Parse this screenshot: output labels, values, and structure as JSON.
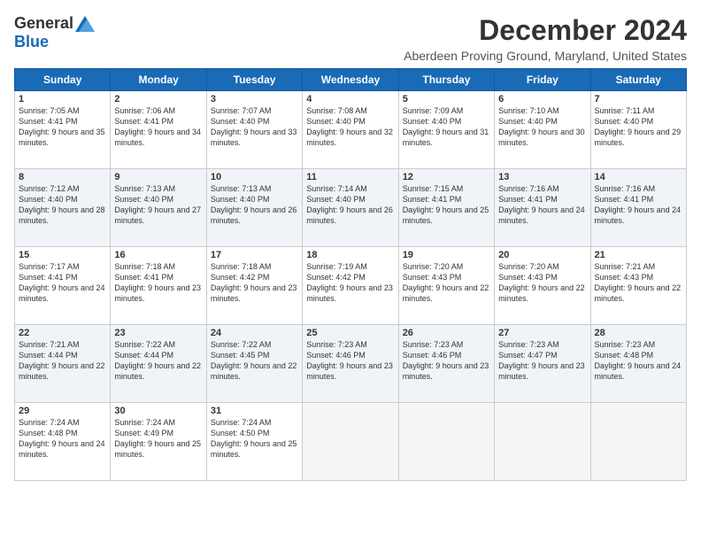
{
  "header": {
    "logo_general": "General",
    "logo_blue": "Blue",
    "main_title": "December 2024",
    "subtitle": "Aberdeen Proving Ground, Maryland, United States"
  },
  "calendar": {
    "days_of_week": [
      "Sunday",
      "Monday",
      "Tuesday",
      "Wednesday",
      "Thursday",
      "Friday",
      "Saturday"
    ],
    "weeks": [
      [
        {
          "day": "1",
          "sunrise": "Sunrise: 7:05 AM",
          "sunset": "Sunset: 4:41 PM",
          "daylight": "Daylight: 9 hours and 35 minutes."
        },
        {
          "day": "2",
          "sunrise": "Sunrise: 7:06 AM",
          "sunset": "Sunset: 4:41 PM",
          "daylight": "Daylight: 9 hours and 34 minutes."
        },
        {
          "day": "3",
          "sunrise": "Sunrise: 7:07 AM",
          "sunset": "Sunset: 4:40 PM",
          "daylight": "Daylight: 9 hours and 33 minutes."
        },
        {
          "day": "4",
          "sunrise": "Sunrise: 7:08 AM",
          "sunset": "Sunset: 4:40 PM",
          "daylight": "Daylight: 9 hours and 32 minutes."
        },
        {
          "day": "5",
          "sunrise": "Sunrise: 7:09 AM",
          "sunset": "Sunset: 4:40 PM",
          "daylight": "Daylight: 9 hours and 31 minutes."
        },
        {
          "day": "6",
          "sunrise": "Sunrise: 7:10 AM",
          "sunset": "Sunset: 4:40 PM",
          "daylight": "Daylight: 9 hours and 30 minutes."
        },
        {
          "day": "7",
          "sunrise": "Sunrise: 7:11 AM",
          "sunset": "Sunset: 4:40 PM",
          "daylight": "Daylight: 9 hours and 29 minutes."
        }
      ],
      [
        {
          "day": "8",
          "sunrise": "Sunrise: 7:12 AM",
          "sunset": "Sunset: 4:40 PM",
          "daylight": "Daylight: 9 hours and 28 minutes."
        },
        {
          "day": "9",
          "sunrise": "Sunrise: 7:13 AM",
          "sunset": "Sunset: 4:40 PM",
          "daylight": "Daylight: 9 hours and 27 minutes."
        },
        {
          "day": "10",
          "sunrise": "Sunrise: 7:13 AM",
          "sunset": "Sunset: 4:40 PM",
          "daylight": "Daylight: 9 hours and 26 minutes."
        },
        {
          "day": "11",
          "sunrise": "Sunrise: 7:14 AM",
          "sunset": "Sunset: 4:40 PM",
          "daylight": "Daylight: 9 hours and 26 minutes."
        },
        {
          "day": "12",
          "sunrise": "Sunrise: 7:15 AM",
          "sunset": "Sunset: 4:41 PM",
          "daylight": "Daylight: 9 hours and 25 minutes."
        },
        {
          "day": "13",
          "sunrise": "Sunrise: 7:16 AM",
          "sunset": "Sunset: 4:41 PM",
          "daylight": "Daylight: 9 hours and 24 minutes."
        },
        {
          "day": "14",
          "sunrise": "Sunrise: 7:16 AM",
          "sunset": "Sunset: 4:41 PM",
          "daylight": "Daylight: 9 hours and 24 minutes."
        }
      ],
      [
        {
          "day": "15",
          "sunrise": "Sunrise: 7:17 AM",
          "sunset": "Sunset: 4:41 PM",
          "daylight": "Daylight: 9 hours and 24 minutes."
        },
        {
          "day": "16",
          "sunrise": "Sunrise: 7:18 AM",
          "sunset": "Sunset: 4:41 PM",
          "daylight": "Daylight: 9 hours and 23 minutes."
        },
        {
          "day": "17",
          "sunrise": "Sunrise: 7:18 AM",
          "sunset": "Sunset: 4:42 PM",
          "daylight": "Daylight: 9 hours and 23 minutes."
        },
        {
          "day": "18",
          "sunrise": "Sunrise: 7:19 AM",
          "sunset": "Sunset: 4:42 PM",
          "daylight": "Daylight: 9 hours and 23 minutes."
        },
        {
          "day": "19",
          "sunrise": "Sunrise: 7:20 AM",
          "sunset": "Sunset: 4:43 PM",
          "daylight": "Daylight: 9 hours and 22 minutes."
        },
        {
          "day": "20",
          "sunrise": "Sunrise: 7:20 AM",
          "sunset": "Sunset: 4:43 PM",
          "daylight": "Daylight: 9 hours and 22 minutes."
        },
        {
          "day": "21",
          "sunrise": "Sunrise: 7:21 AM",
          "sunset": "Sunset: 4:43 PM",
          "daylight": "Daylight: 9 hours and 22 minutes."
        }
      ],
      [
        {
          "day": "22",
          "sunrise": "Sunrise: 7:21 AM",
          "sunset": "Sunset: 4:44 PM",
          "daylight": "Daylight: 9 hours and 22 minutes."
        },
        {
          "day": "23",
          "sunrise": "Sunrise: 7:22 AM",
          "sunset": "Sunset: 4:44 PM",
          "daylight": "Daylight: 9 hours and 22 minutes."
        },
        {
          "day": "24",
          "sunrise": "Sunrise: 7:22 AM",
          "sunset": "Sunset: 4:45 PM",
          "daylight": "Daylight: 9 hours and 22 minutes."
        },
        {
          "day": "25",
          "sunrise": "Sunrise: 7:23 AM",
          "sunset": "Sunset: 4:46 PM",
          "daylight": "Daylight: 9 hours and 23 minutes."
        },
        {
          "day": "26",
          "sunrise": "Sunrise: 7:23 AM",
          "sunset": "Sunset: 4:46 PM",
          "daylight": "Daylight: 9 hours and 23 minutes."
        },
        {
          "day": "27",
          "sunrise": "Sunrise: 7:23 AM",
          "sunset": "Sunset: 4:47 PM",
          "daylight": "Daylight: 9 hours and 23 minutes."
        },
        {
          "day": "28",
          "sunrise": "Sunrise: 7:23 AM",
          "sunset": "Sunset: 4:48 PM",
          "daylight": "Daylight: 9 hours and 24 minutes."
        }
      ],
      [
        {
          "day": "29",
          "sunrise": "Sunrise: 7:24 AM",
          "sunset": "Sunset: 4:48 PM",
          "daylight": "Daylight: 9 hours and 24 minutes."
        },
        {
          "day": "30",
          "sunrise": "Sunrise: 7:24 AM",
          "sunset": "Sunset: 4:49 PM",
          "daylight": "Daylight: 9 hours and 25 minutes."
        },
        {
          "day": "31",
          "sunrise": "Sunrise: 7:24 AM",
          "sunset": "Sunset: 4:50 PM",
          "daylight": "Daylight: 9 hours and 25 minutes."
        },
        null,
        null,
        null,
        null
      ]
    ]
  }
}
